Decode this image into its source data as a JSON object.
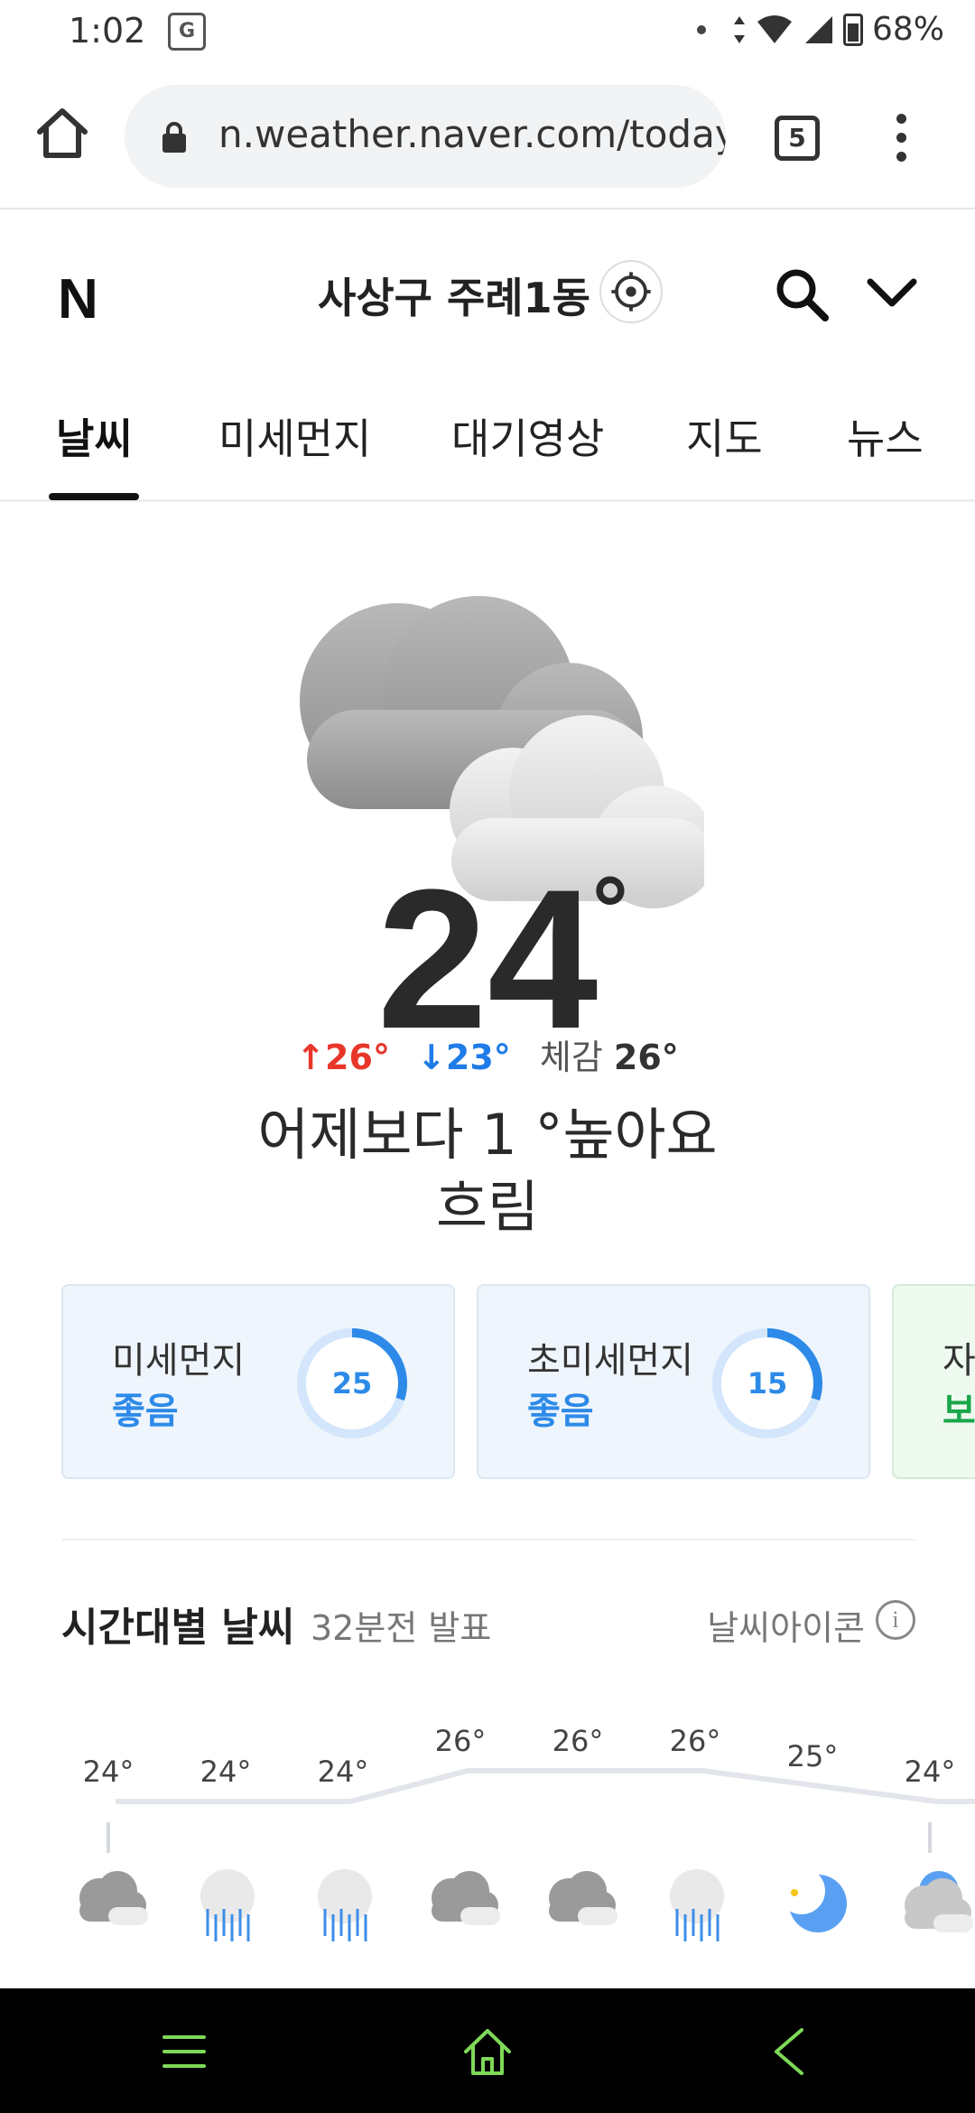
{
  "status_bar": {
    "time": "1:02",
    "translate_icon": "G",
    "battery": "68%",
    "icons": [
      "translate-icon",
      "dot-icon",
      "data-arrows-icon",
      "wifi-icon",
      "signal-icon",
      "battery-icon"
    ]
  },
  "browser": {
    "url": "n.weather.naver.com/today",
    "tab_count": "5",
    "icons": [
      "home-icon",
      "lock-icon",
      "tabs-icon",
      "more-vert-icon"
    ]
  },
  "header": {
    "logo": "N",
    "location": "사상구 주례1동",
    "icons": [
      "my-location-icon",
      "search-icon",
      "chevron-down-icon"
    ]
  },
  "tabs": [
    {
      "label": "날씨",
      "active": true
    },
    {
      "label": "미세먼지",
      "active": false
    },
    {
      "label": "대기영상",
      "active": false
    },
    {
      "label": "지도",
      "active": false
    },
    {
      "label": "뉴스",
      "active": false
    }
  ],
  "current": {
    "icon": "cloudy-icon",
    "temperature": "24",
    "degree": "°",
    "high": "↑26°",
    "low": "↓23°",
    "feels_label": "체감",
    "feels_value": "26°",
    "compare": "어제보다 1 °높아요",
    "condition": "흐림"
  },
  "air": [
    {
      "name": "미세먼지",
      "grade": "좋음",
      "value": "25",
      "fill_fraction": 0.3,
      "color": "#2d8ae8"
    },
    {
      "name": "초미세먼지",
      "grade": "좋음",
      "value": "15",
      "fill_fraction": 0.3,
      "color": "#2d8ae8"
    },
    {
      "name": "자",
      "grade": "보",
      "value": "",
      "fill_fraction": 0,
      "color": "#1aa64a"
    }
  ],
  "hourly": {
    "title": "시간대별 날씨",
    "subtitle": "32분전 발표",
    "icon_toggle": "날씨아이콘",
    "info_icon": "i",
    "temps": [
      "24°",
      "24°",
      "24°",
      "26°",
      "26°",
      "26°",
      "25°",
      "24°"
    ],
    "temp_values": [
      24,
      24,
      24,
      26,
      26,
      26,
      25,
      24
    ],
    "icons": [
      "cloudy-icon",
      "rain-icon",
      "rain-icon",
      "cloudy-icon",
      "cloudy-icon",
      "rain-icon",
      "moon-icon",
      "cloudy-night-icon"
    ]
  },
  "nav_bar": {
    "icons": [
      "menu-icon",
      "home-icon",
      "back-icon"
    ],
    "color": "#7ed957"
  }
}
